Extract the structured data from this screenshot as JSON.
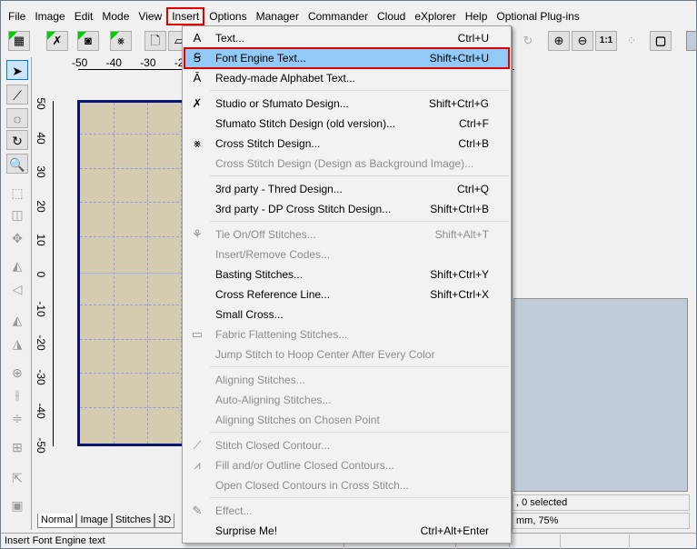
{
  "menubar": [
    "File",
    "Image",
    "Edit",
    "Mode",
    "View",
    "Insert",
    "Options",
    "Manager",
    "Commander",
    "Cloud",
    "eXplorer",
    "Help",
    "Optional Plug-ins"
  ],
  "active_menu": "Insert",
  "toolbar": {
    "icons": [
      "hoop-grid-icon",
      "wand-icon",
      "camera-icon",
      "cross-stitch-icon",
      "new-page-icon",
      "open-folder-icon"
    ],
    "right_icons": [
      "redo-icon",
      "zoom-in-icon",
      "zoom-out-icon",
      "zoom-1-1-icon",
      "zoom-fit-icon",
      "stop-icon"
    ],
    "zoom_1_1": "1:1"
  },
  "left_tools": [
    "select-arrow-icon",
    "node-edit-icon",
    "lasso-icon",
    "rotate-icon",
    "magnifier-icon",
    "rectangle-select-icon",
    "resize-icon",
    "move-icon",
    "mirror-horizontal-icon",
    "mirror-vertical-icon",
    "rotate-left-icon",
    "rotate-right-icon",
    "center-icon",
    "align-horizontal-icon",
    "align-vertical-icon",
    "distribute-icon",
    "pointer-icon",
    "page-icon"
  ],
  "ruler": {
    "top": [
      "-50",
      "-40",
      "-30",
      "-2"
    ],
    "left": [
      "50",
      "40",
      "30",
      "20",
      "10",
      "0",
      "-10",
      "-20",
      "-30",
      "-40",
      "-50"
    ]
  },
  "view_tabs": [
    "Normal",
    "Image",
    "Stitches",
    "3D"
  ],
  "active_tab": "Normal",
  "right_info": {
    "selection": ", 0 selected",
    "size": "mm, 75%"
  },
  "status_text": "Insert Font Engine text",
  "menu_items": [
    {
      "icon": "A",
      "label": "Text...",
      "shortcut": "Ctrl+U",
      "enabled": true
    },
    {
      "icon": "Ꞩ",
      "label": "Font Engine Text...",
      "shortcut": "Shift+Ctrl+U",
      "enabled": true,
      "highlighted": true
    },
    {
      "icon": "Ā",
      "label": "Ready-made Alphabet Text...",
      "shortcut": "",
      "enabled": true
    },
    {
      "sep": true
    },
    {
      "icon": "✗",
      "label": "Studio or Sfumato Design...",
      "shortcut": "Shift+Ctrl+G",
      "enabled": true
    },
    {
      "icon": "",
      "label": "Sfumato Stitch Design (old version)...",
      "shortcut": "Ctrl+F",
      "enabled": true
    },
    {
      "icon": "⨳",
      "label": "Cross Stitch Design...",
      "shortcut": "Ctrl+B",
      "enabled": true
    },
    {
      "icon": "",
      "label": "Cross Stitch Design (Design as Background Image)...",
      "shortcut": "",
      "enabled": false
    },
    {
      "sep": true
    },
    {
      "icon": "",
      "label": "3rd party - Thred Design...",
      "shortcut": "Ctrl+Q",
      "enabled": true
    },
    {
      "icon": "",
      "label": "3rd party - DP Cross Stitch Design...",
      "shortcut": "Shift+Ctrl+B",
      "enabled": true
    },
    {
      "sep": true
    },
    {
      "icon": "⚘",
      "label": "Tie On/Off Stitches...",
      "shortcut": "Shift+Alt+T",
      "enabled": false
    },
    {
      "icon": "",
      "label": "Insert/Remove Codes...",
      "shortcut": "",
      "enabled": false
    },
    {
      "icon": "",
      "label": "Basting Stitches...",
      "shortcut": "Shift+Ctrl+Y",
      "enabled": true
    },
    {
      "icon": "",
      "label": "Cross Reference Line...",
      "shortcut": "Shift+Ctrl+X",
      "enabled": true
    },
    {
      "icon": "",
      "label": "Small Cross...",
      "shortcut": "",
      "enabled": true
    },
    {
      "icon": "▭",
      "label": "Fabric Flattening Stitches...",
      "shortcut": "",
      "enabled": false
    },
    {
      "icon": "",
      "label": "Jump Stitch to Hoop Center After Every Color",
      "shortcut": "",
      "enabled": false
    },
    {
      "sep": true
    },
    {
      "icon": "",
      "label": "Aligning Stitches...",
      "shortcut": "",
      "enabled": false
    },
    {
      "icon": "",
      "label": "Auto-Aligning Stitches...",
      "shortcut": "",
      "enabled": false
    },
    {
      "icon": "",
      "label": "Aligning Stitches on Chosen Point",
      "shortcut": "",
      "enabled": false
    },
    {
      "sep": true
    },
    {
      "icon": "⟋",
      "label": "Stitch Closed Contour...",
      "shortcut": "",
      "enabled": false
    },
    {
      "icon": "⩘",
      "label": "Fill and/or Outline Closed Contours...",
      "shortcut": "",
      "enabled": false
    },
    {
      "icon": "",
      "label": "Open Closed Contours in Cross Stitch...",
      "shortcut": "",
      "enabled": false
    },
    {
      "sep": true
    },
    {
      "icon": "✎",
      "label": "Effect...",
      "shortcut": "",
      "enabled": false
    },
    {
      "icon": "",
      "label": "Surprise Me!",
      "shortcut": "Ctrl+Alt+Enter",
      "enabled": true
    }
  ],
  "colors": {
    "highlight": "#91c9f7",
    "highlight_border": "#e00000",
    "design_fill": "#d4cbb0",
    "design_border": "#0a1475",
    "preview_panel": "#c0cdd9"
  }
}
